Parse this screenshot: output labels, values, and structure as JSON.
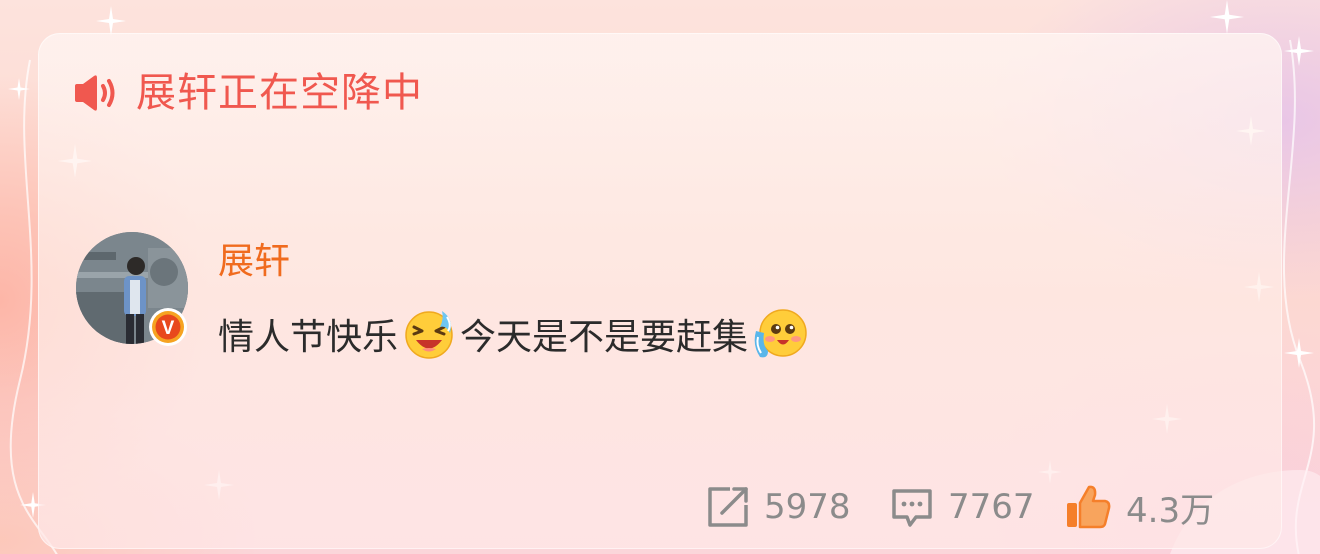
{
  "broadcast": {
    "title": "展轩正在空降中",
    "icon": "speaker-icon"
  },
  "post": {
    "author": "展轩",
    "verified_badge": "V",
    "text_part1": "情人节快乐",
    "text_part2": "今天是不是要赶集",
    "emoji1": "laughing-crying-emoji",
    "emoji2": "shy-blush-emoji"
  },
  "stats": {
    "repost_count": "5978",
    "comment_count": "7767",
    "like_count": "4.3万"
  },
  "colors": {
    "accent_red": "#f0584f",
    "author_orange": "#f06b1e",
    "stat_gray": "#8b8b8b",
    "like_orange": "#f57f2a"
  }
}
